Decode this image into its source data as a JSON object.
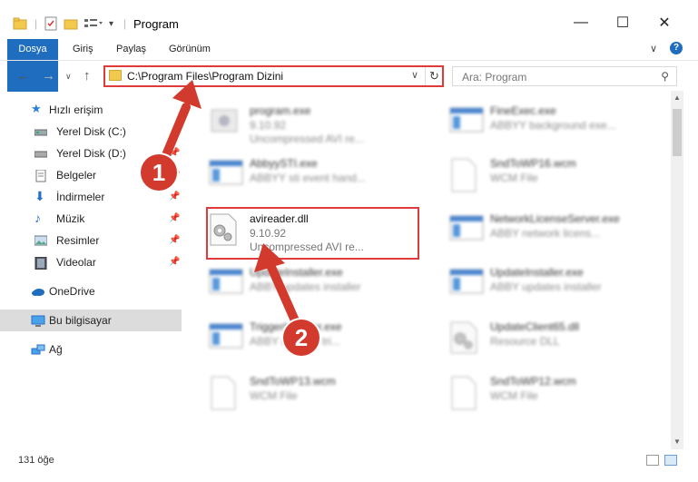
{
  "window": {
    "title": "Program",
    "minimize": "—",
    "maximize": "☐",
    "close": "✕"
  },
  "ribbon": {
    "tabs": [
      "Dosya",
      "Giriş",
      "Paylaş",
      "Görünüm"
    ],
    "help": "?"
  },
  "address": {
    "path": "C:\\Program Files\\Program Dizini",
    "search_placeholder": "Ara: Program"
  },
  "sidebar": {
    "quick_access": "Hızlı erişim",
    "items": [
      {
        "label": "Yerel Disk (C:)",
        "icon": "drive-icon",
        "pinned": false
      },
      {
        "label": "Yerel Disk (D:)",
        "icon": "drive-icon",
        "pinned": true
      },
      {
        "label": "Belgeler",
        "icon": "documents-icon",
        "pinned": true
      },
      {
        "label": "İndirmeler",
        "icon": "downloads-icon",
        "pinned": true
      },
      {
        "label": "Müzik",
        "icon": "music-icon",
        "pinned": true
      },
      {
        "label": "Resimler",
        "icon": "pictures-icon",
        "pinned": true
      },
      {
        "label": "Videolar",
        "icon": "videos-icon",
        "pinned": true
      }
    ],
    "onedrive": "OneDrive",
    "this_pc": "Bu bilgisayar",
    "network": "Ağ"
  },
  "files": [
    {
      "name": "program.exe",
      "line1": "9.10.92",
      "line2": "Uncompressed AVI re...",
      "icon": "app-icon"
    },
    {
      "name": "FineExec.exe",
      "line1": "ABBYY background exe...",
      "line2": "",
      "icon": "window-icon"
    },
    {
      "name": "AbbyySTI.exe",
      "line1": "ABBYY sti event hand...",
      "line2": "",
      "icon": "window-icon"
    },
    {
      "name": "SndToWP16.wcm",
      "line1": "WCM File",
      "line2": "",
      "icon": "blank-file-icon"
    },
    {
      "name": "avireader.dll",
      "line1": "9.10.92",
      "line2": "Uncompressed AVI re...",
      "icon": "dll-gear-icon"
    },
    {
      "name": "NetworkLicenseServer.exe",
      "line1": "ABBY network licens...",
      "line2": "",
      "icon": "window-icon"
    },
    {
      "name": "UpdateInstaller.exe",
      "line1": "ABBY updates installer",
      "line2": "",
      "icon": "window-icon"
    },
    {
      "name": "UpdateInstaller.exe",
      "line1": "ABBY updates installer",
      "line2": "",
      "icon": "window-icon"
    },
    {
      "name": "TriggerInstaller.exe",
      "line1": "ABBY installer tri...",
      "line2": "",
      "icon": "window-icon"
    },
    {
      "name": "UpdateClient65.dll",
      "line1": "Resource DLL",
      "line2": "",
      "icon": "dll-gear-icon"
    },
    {
      "name": "SndToWP13.wcm",
      "line1": "WCM File",
      "line2": "",
      "icon": "blank-file-icon"
    },
    {
      "name": "SndToWP12.wcm",
      "line1": "WCM File",
      "line2": "",
      "icon": "blank-file-icon"
    }
  ],
  "status": {
    "count": "131 öğe"
  },
  "callouts": [
    "1",
    "2"
  ],
  "colors": {
    "accent": "#1f6dbe",
    "highlight_red": "#e03b3b",
    "callout_red": "#d23a2d"
  }
}
